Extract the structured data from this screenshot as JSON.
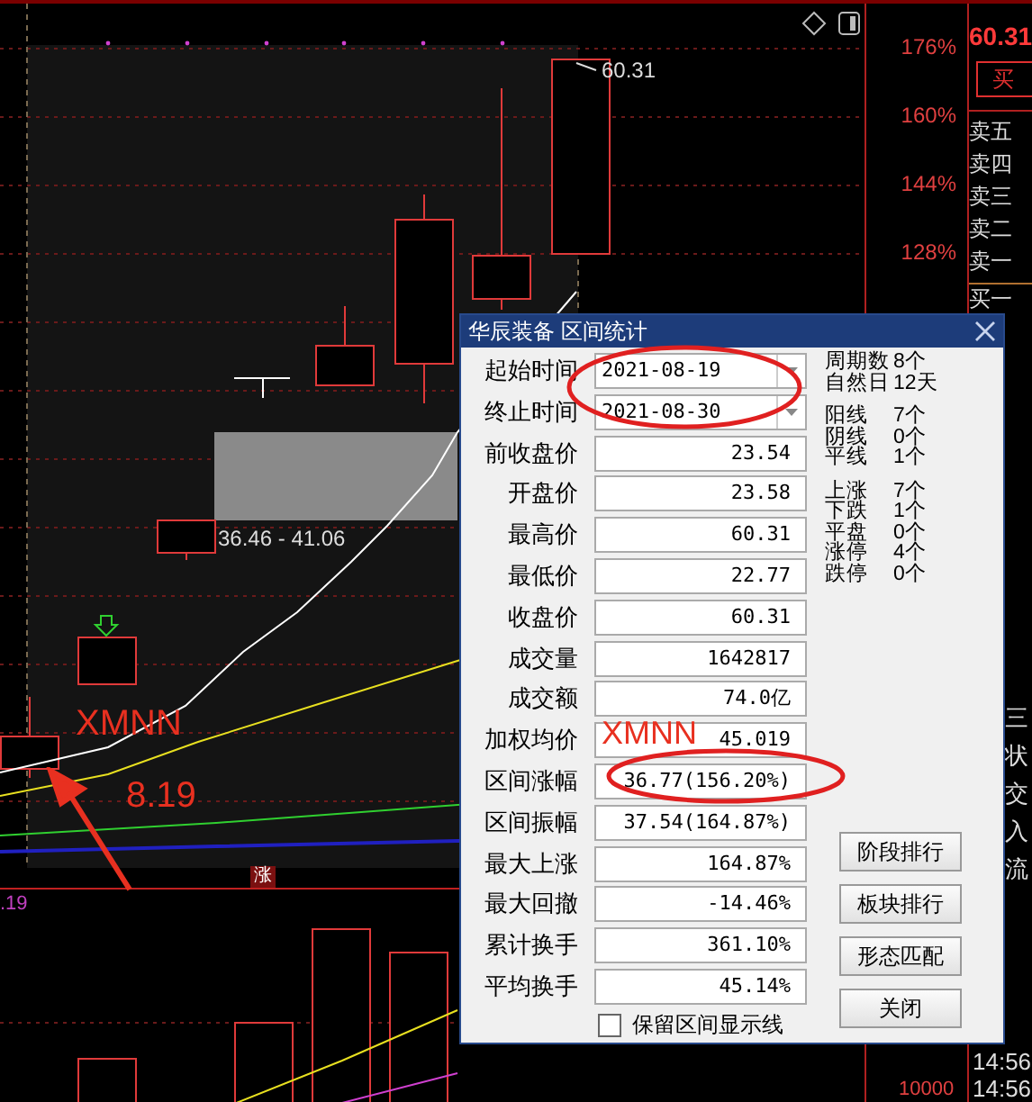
{
  "chart": {
    "high_label": "60.31",
    "range_label": "36.46 - 41.06",
    "limit_tag": "涨",
    "left_value": ".19",
    "annotations": [
      "XMNN",
      "8.19"
    ]
  },
  "axis": {
    "ticks": [
      "176%",
      "160%",
      "144%",
      "128%"
    ],
    "volume_tick": "10000"
  },
  "quote_panel": {
    "last_price": "60.31",
    "buy_button": "买",
    "asks": [
      "卖五",
      "卖四",
      "卖三",
      "卖二",
      "卖一"
    ],
    "bid": "买一",
    "side_items": [
      "三",
      "状",
      "交",
      "入",
      "流"
    ],
    "times": [
      "14:56",
      "14:56"
    ]
  },
  "dialog": {
    "title": "华辰装备 区间统计",
    "dates": [
      {
        "label": "起始时间",
        "value": "2021-08-19"
      },
      {
        "label": "终止时间",
        "value": "2021-08-30"
      }
    ],
    "fields": [
      {
        "label": "前收盘价",
        "value": "23.54"
      },
      {
        "label": "开盘价",
        "value": "23.58"
      },
      {
        "label": "最高价",
        "value": "60.31"
      },
      {
        "label": "最低价",
        "value": "22.77"
      },
      {
        "label": "收盘价",
        "value": "60.31"
      },
      {
        "label": "成交量",
        "value": "1642817"
      },
      {
        "label": "成交额",
        "value": "74.0亿"
      },
      {
        "label": "加权均价",
        "value": "45.019"
      },
      {
        "label": "区间涨幅",
        "value": "36.77(156.20%)"
      },
      {
        "label": "区间振幅",
        "value": "37.54(164.87%)"
      },
      {
        "label": "最大上涨",
        "value": "164.87%"
      },
      {
        "label": "最大回撤",
        "value": "-14.46%"
      },
      {
        "label": "累计换手",
        "value": "361.10%"
      },
      {
        "label": "平均换手",
        "value": "45.14%"
      }
    ],
    "stat_groups": [
      {
        "items": [
          {
            "label": "周期数",
            "value": "8个"
          },
          {
            "label": "自然日",
            "value": "12天"
          }
        ]
      },
      {
        "items": [
          {
            "label": "阳线",
            "value": "7个"
          },
          {
            "label": "阴线",
            "value": "0个"
          },
          {
            "label": "平线",
            "value": "1个"
          }
        ]
      },
      {
        "items": [
          {
            "label": "上涨",
            "value": "7个"
          },
          {
            "label": "下跌",
            "value": "1个"
          },
          {
            "label": "平盘",
            "value": "0个"
          },
          {
            "label": "涨停",
            "value": "4个"
          },
          {
            "label": "跌停",
            "value": "0个"
          }
        ]
      }
    ],
    "retain_lines": {
      "label": "保留区间显示线",
      "checked": false
    },
    "buttons": [
      "阶段排行",
      "板块排行",
      "形态匹配",
      "关闭"
    ],
    "annotation": "XMNN"
  }
}
